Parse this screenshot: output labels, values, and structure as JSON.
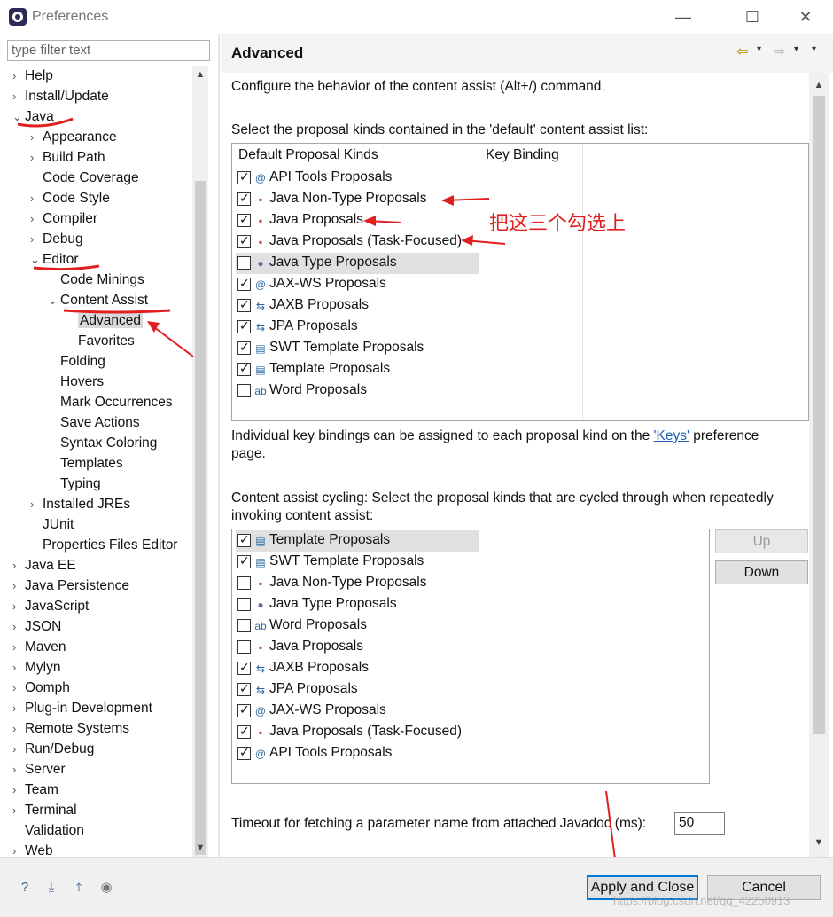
{
  "window": {
    "title": "Preferences",
    "minimize": "—",
    "maximize": "☐",
    "close": "✕"
  },
  "filter": {
    "placeholder": "type filter text"
  },
  "tree": [
    {
      "label": "Help",
      "chev": "›"
    },
    {
      "label": "Install/Update",
      "chev": "›"
    },
    {
      "label": "Java",
      "chev": "⌄"
    },
    {
      "label": "Appearance",
      "chev": "›"
    },
    {
      "label": "Build Path",
      "chev": "›"
    },
    {
      "label": "Code Coverage",
      "chev": ""
    },
    {
      "label": "Code Style",
      "chev": "›"
    },
    {
      "label": "Compiler",
      "chev": "›"
    },
    {
      "label": "Debug",
      "chev": "›"
    },
    {
      "label": "Editor",
      "chev": "⌄"
    },
    {
      "label": "Code Minings",
      "chev": ""
    },
    {
      "label": "Content Assist",
      "chev": "⌄"
    },
    {
      "label": "Advanced",
      "chev": ""
    },
    {
      "label": "Favorites",
      "chev": ""
    },
    {
      "label": "Folding",
      "chev": ""
    },
    {
      "label": "Hovers",
      "chev": ""
    },
    {
      "label": "Mark Occurrences",
      "chev": ""
    },
    {
      "label": "Save Actions",
      "chev": ""
    },
    {
      "label": "Syntax Coloring",
      "chev": ""
    },
    {
      "label": "Templates",
      "chev": ""
    },
    {
      "label": "Typing",
      "chev": ""
    },
    {
      "label": "Installed JREs",
      "chev": "›"
    },
    {
      "label": "JUnit",
      "chev": ""
    },
    {
      "label": "Properties Files Editor",
      "chev": ""
    },
    {
      "label": "Java EE",
      "chev": "›"
    },
    {
      "label": "Java Persistence",
      "chev": "›"
    },
    {
      "label": "JavaScript",
      "chev": "›"
    },
    {
      "label": "JSON",
      "chev": "›"
    },
    {
      "label": "Maven",
      "chev": "›"
    },
    {
      "label": "Mylyn",
      "chev": "›"
    },
    {
      "label": "Oomph",
      "chev": "›"
    },
    {
      "label": "Plug-in Development",
      "chev": "›"
    },
    {
      "label": "Remote Systems",
      "chev": "›"
    },
    {
      "label": "Run/Debug",
      "chev": "›"
    },
    {
      "label": "Server",
      "chev": "›"
    },
    {
      "label": "Team",
      "chev": "›"
    },
    {
      "label": "Terminal",
      "chev": "›"
    },
    {
      "label": "Validation",
      "chev": ""
    },
    {
      "label": "Web",
      "chev": "›"
    }
  ],
  "page": {
    "title": "Advanced",
    "nav_back": "⇦",
    "nav_forward": "⇨",
    "nav_menu": "▾",
    "intro": "Configure the behavior of the content assist (Alt+/) command.",
    "default_heading": "Select the proposal kinds contained in the 'default' content assist list:",
    "col_kinds": "Default Proposal Kinds",
    "col_binding": "Key Binding",
    "default_list": [
      {
        "label": "API Tools Proposals",
        "checked": true,
        "icon": "@"
      },
      {
        "label": "Java Non-Type Proposals",
        "checked": true,
        "icon": "▪"
      },
      {
        "label": "Java Proposals",
        "checked": true,
        "icon": "▪"
      },
      {
        "label": "Java Proposals (Task-Focused)",
        "checked": true,
        "icon": "▪"
      },
      {
        "label": "Java Type Proposals",
        "checked": false,
        "icon": "●"
      },
      {
        "label": "JAX-WS Proposals",
        "checked": true,
        "icon": "@"
      },
      {
        "label": "JAXB Proposals",
        "checked": true,
        "icon": "⇆"
      },
      {
        "label": "JPA Proposals",
        "checked": true,
        "icon": "⇆"
      },
      {
        "label": "SWT Template Proposals",
        "checked": true,
        "icon": "▤"
      },
      {
        "label": "Template Proposals",
        "checked": true,
        "icon": "▤"
      },
      {
        "label": "Word Proposals",
        "checked": false,
        "icon": "ab"
      }
    ],
    "keys_text_1": "Individual key bindings can be assigned to each proposal kind on the ",
    "keys_link": "'Keys'",
    "keys_text_2": " preference",
    "keys_text_3": "page.",
    "cycling_line1": "Content assist cycling: Select the proposal kinds that are cycled through when repeatedly",
    "cycling_line2": "invoking content assist:",
    "cycling_list": [
      {
        "label": "Template Proposals",
        "checked": true,
        "icon": "▤"
      },
      {
        "label": "SWT Template Proposals",
        "checked": true,
        "icon": "▤"
      },
      {
        "label": "Java Non-Type Proposals",
        "checked": false,
        "icon": "▪"
      },
      {
        "label": "Java Type Proposals",
        "checked": false,
        "icon": "●"
      },
      {
        "label": "Word Proposals",
        "checked": false,
        "icon": "ab"
      },
      {
        "label": "Java Proposals",
        "checked": false,
        "icon": "▪"
      },
      {
        "label": "JAXB Proposals",
        "checked": true,
        "icon": "⇆"
      },
      {
        "label": "JPA Proposals",
        "checked": true,
        "icon": "⇆"
      },
      {
        "label": "JAX-WS Proposals",
        "checked": true,
        "icon": "@"
      },
      {
        "label": "Java Proposals (Task-Focused)",
        "checked": true,
        "icon": "▪"
      },
      {
        "label": "API Tools Proposals",
        "checked": true,
        "icon": "@"
      }
    ],
    "up_label": "Up",
    "down_label": "Down",
    "timeout_label": "Timeout for fetching a parameter name from attached Javadoc (ms):",
    "timeout_value": "50"
  },
  "annotation": {
    "text": "把这三个勾选上"
  },
  "footer": {
    "apply_close": "Apply and Close",
    "cancel": "Cancel",
    "watermark": "https://blog.csdn.net/qq_42250913"
  },
  "colors": {
    "accent": "#0078d7",
    "annotation_red": "#e02020",
    "link": "#1a5fb4"
  }
}
